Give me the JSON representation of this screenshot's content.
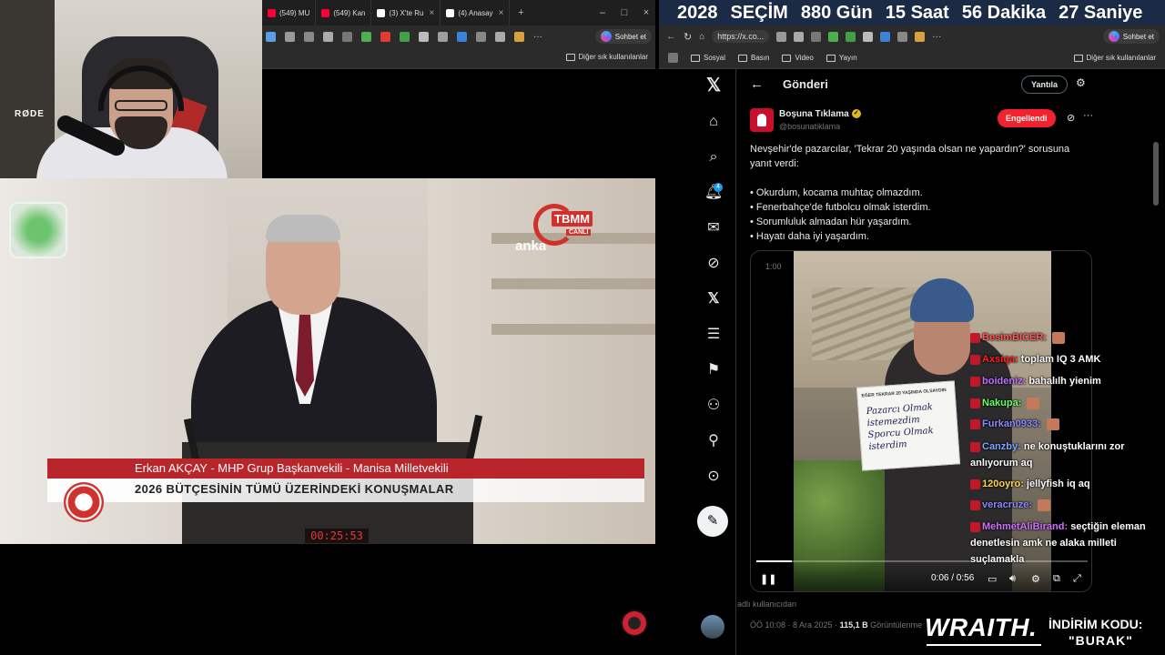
{
  "left_browser": {
    "tabs": [
      {
        "label": "(549) MU",
        "color": "#ff0033"
      },
      {
        "label": "(549) Kan",
        "color": "#ff0033"
      },
      {
        "label": "(3) X'te Ru",
        "color": "#ffffff"
      },
      {
        "label": "(4) Anasay",
        "color": "#ffffff"
      }
    ],
    "new_tab": "+",
    "chat_button": "Sohbet et",
    "bookmarks_other": "Diğer sık kullanılanlar"
  },
  "webcam": {
    "mic_brand": "RØDE"
  },
  "video": {
    "logo_text": "TBMM",
    "logo_sub": "CANLI",
    "agency": "anka",
    "speaker_line": "Erkan AKÇAY - MHP Grup Başkanvekili - Manisa Milletvekili",
    "topic_line": "2026 BÜTÇESİNİN TÜMÜ ÜZERİNDEKİ KONUŞMALAR",
    "clock": "00:25:53"
  },
  "right_browser": {
    "countdown": {
      "a": "2028",
      "b": "SEÇİM",
      "c": "880 Gün",
      "d": "15 Saat",
      "e": "56 Dakika",
      "f": "27 Saniye"
    },
    "url": "https://x.co...",
    "chat_button": "Sohbet et",
    "bookmarks": [
      "Sosyal",
      "Basın",
      "Video",
      "Yayın"
    ],
    "bookmarks_other": "Diğer sık kullanılanlar"
  },
  "x": {
    "header_title": "Gönderi",
    "reply_button": "Yantıla",
    "notification_count": "4",
    "author": {
      "name": "Boşuna Tıklama",
      "handle": "@bosunatiklama"
    },
    "blocked_button": "Engellendi",
    "post_intro": "Nevşehir'de pazarcılar, 'Tekrar 20 yaşında olsan ne yapardın?' sorusuna yanıt verdi:",
    "bullets": [
      "• Okurdum, kocama muhtaç olmazdım.",
      "• Fenerbahçe'de futbolcu olmak isterdim.",
      "• Sorumluluk almadan hür yaşardım.",
      "• Hayatı daha iyi yaşardım."
    ],
    "media": {
      "top_time": "1:00",
      "sign_header": "EĞER TEKRAR 20 YAŞINDA OLSAYDIN",
      "sign_lines": [
        "Pazarcı Olmak",
        "istemezdim",
        "Sporcu Olmak",
        "isterdim"
      ],
      "time": "0:06 / 0:56",
      "progress": 0.107
    },
    "caption_fragment": "adlı kullanıcıdan",
    "meta_time": "ÖÖ 10:08 · 8 Ara 2025 · ",
    "meta_views": "115,1 B",
    "meta_views_label": " Görüntülenme"
  },
  "chat": [
    {
      "user": "BesimBICER:",
      "msg": "",
      "color": "#ff5a5a",
      "emote": true
    },
    {
      "user": "Axsiqa:",
      "msg": "toplam IQ 3 AMK",
      "color": "#ff2020",
      "emote": false
    },
    {
      "user": "boideniz:",
      "msg": "bahalılh yienim",
      "color": "#c070ff",
      "emote": false
    },
    {
      "user": "Nakupa:",
      "msg": "",
      "color": "#6aff6a",
      "emote": true
    },
    {
      "user": "Furkan0933:",
      "msg": "",
      "color": "#8a8aff",
      "emote": true
    },
    {
      "user": "Canzby:",
      "msg": "ne konuştuklarını zor",
      "color": "#7aa8ff",
      "emote": false
    },
    {
      "user": "",
      "msg": "anlıyorum aq",
      "color": "#fff",
      "emote": false
    },
    {
      "user": "120oyro:",
      "msg": "jellyfish iq aq",
      "color": "#ffd84a",
      "emote": false
    },
    {
      "user": "veracruze:",
      "msg": "",
      "color": "#8a8aff",
      "emote": true
    },
    {
      "user": "MehmetAliBirand:",
      "msg": "seçtiğin eleman",
      "color": "#d070ff",
      "emote": false
    },
    {
      "user": "",
      "msg": "denetlesin amk ne alaka milleti",
      "color": "#fff",
      "emote": false
    },
    {
      "user": "",
      "msg": "suçlamakla",
      "color": "#fff",
      "emote": false
    }
  ],
  "promo": {
    "brand": "WRAITH.",
    "label": "İNDİRİM KODU:",
    "code": "\"BURAK\""
  }
}
